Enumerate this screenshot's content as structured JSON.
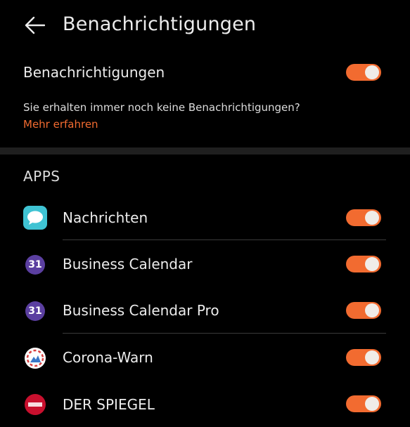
{
  "header": {
    "title": "Benachrichtigungen",
    "back_icon": "arrow-left-icon"
  },
  "main_toggle": {
    "label": "Benachrichtigungen",
    "enabled": true
  },
  "hint": {
    "text": "Sie erhalten immer noch keine Benachrichtigungen?",
    "link": "Mehr erfahren"
  },
  "apps_section": {
    "title": "APPS",
    "items": [
      {
        "name": "Nachrichten",
        "icon": "messages-icon",
        "enabled": true
      },
      {
        "name": "Business Calendar",
        "icon": "calendar-icon",
        "icon_text": "31",
        "enabled": true
      },
      {
        "name": "Business Calendar Pro",
        "icon": "calendar-icon",
        "icon_text": "31",
        "enabled": true
      },
      {
        "name": "Corona-Warn",
        "icon": "corona-warn-icon",
        "enabled": true
      },
      {
        "name": "DER SPIEGEL",
        "icon": "spiegel-icon",
        "enabled": true
      }
    ]
  },
  "colors": {
    "background": "#000000",
    "accent": "#f26b30",
    "text": "#ececec",
    "divider": "#1f1f1f"
  }
}
